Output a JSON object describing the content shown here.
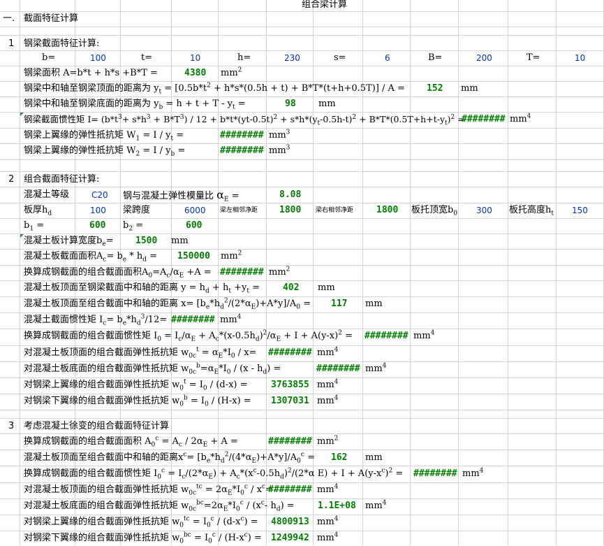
{
  "title": "组合梁计算",
  "s1": {
    "header_num": "一.",
    "header": "截面特征计算",
    "num": "1",
    "label": "钢梁截面特征计算:",
    "params": [
      {
        "k": "b=",
        "v": "100"
      },
      {
        "k": "t=",
        "v": "10"
      },
      {
        "k": "h=",
        "v": "230"
      },
      {
        "k": "s=",
        "v": "6"
      },
      {
        "k": "B=",
        "v": "200"
      },
      {
        "k": "T=",
        "v": "10"
      }
    ],
    "area_label": "钢梁面积  A=b*t + h*s +B*T =",
    "area_val": "4380",
    "area_unit": "mm",
    "yt_label": "钢梁中和轴至钢梁顶面的距离为 y",
    "yt_expr": " = [0.5b*t",
    "yt_expr2": " + h*s*(0.5h + t) + B*T*(t+h+0.5T)] / A =",
    "yt_val": "152",
    "yt_unit": "mm",
    "yb_label": "钢梁中和轴至钢梁底面的距离为 y",
    "yb_expr": " = h + t + T - y",
    "yb_eq": " =",
    "yb_val": "98",
    "yb_unit": "mm",
    "I_label": "钢梁截面惯性矩 I= (b*t",
    "I_expr": "+ s*h",
    "I_expr2": " + B*T",
    "I_expr3": ") / 12 + b*t*(yt-0.5t)",
    "I_expr4": " + s*h*(y",
    "I_expr5": "-0.5h-t)",
    "I_expr6": " + B*T*(0.5T+h+t-y",
    "I_expr7": ")",
    "I_eq": " =",
    "I_val": "########",
    "I_unit": "mm",
    "W1_label": "钢梁上翼缘的弹性抵抗矩 W",
    "W1_expr": " = I / y",
    "W1_eq": " =",
    "W1_val": "########",
    "W1_unit": "mm",
    "W2_label": "钢梁上翼缘的弹性抵抗矩 W",
    "W2_expr": " = I / y",
    "W2_eq": " =",
    "W2_val": "########",
    "W2_unit": "mm"
  },
  "s2": {
    "num": "2",
    "label": "组合截面特征计算:",
    "conc_grade_label": "混凝土等级",
    "conc_grade": "C20",
    "ratio_label": "钢与混凝土弹性模量比",
    "ratio_sym": "α",
    "ratio_sub": "E",
    "ratio_eq": " =",
    "ratio_val": "8.08",
    "hd_label": "板厚h",
    "hd_sub": "d",
    "hd_val": "100",
    "span_label": "梁跨度",
    "span_val": "6000",
    "left_clear_label": "梁左相邻净距",
    "left_clear_val": "1800",
    "right_clear_label": "梁右相邻净距",
    "right_clear_val": "1800",
    "b0_label": "板托顶宽b",
    "b0_sub": "0",
    "b0_val": "300",
    "ht_label": "板托高度h",
    "ht_sub": "t",
    "ht_val": "150",
    "b1_label": "b",
    "b1_sub": "1",
    "b1_eq": " =",
    "b1_val": "600",
    "b2_label": "b",
    "b2_sub": "2",
    "b2_eq": " =",
    "b2_val": "600",
    "be_label": "混凝土板计算宽度b",
    "be_sub": "e",
    "be_eq": "=",
    "be_val": "1500",
    "be_unit": "mm",
    "Ac_label": "混凝土板截面面积A",
    "Ac_expr": "= b",
    "Ac_expr2": " * h",
    "Ac_eq": " =",
    "Ac_val": "150000",
    "Ac_unit": "mm",
    "A0_label": "换算成钢截面的组合截面面积A",
    "A0_expr": "=A",
    "A0_expr2": "/α",
    "A0_expr3": " +A =",
    "A0_val": "########",
    "A0_unit": "mm",
    "y_label": "混凝土板顶面至钢梁截面中和轴的距离 y = h",
    "y_expr": " + h",
    "y_expr2": " +y",
    "y_eq": " =",
    "y_val": "402",
    "y_unit": "mm",
    "x_label": "混凝土板顶面至组合截面中和轴的距离 x= [b",
    "x_expr": "*h",
    "x_expr2": "/(2*α",
    "x_expr3": ")+A*y]/A",
    "x_eq": " =",
    "x_val": "117",
    "x_unit": "mm",
    "Ic_label": "混凝土截面惯性矩 I",
    "Ic_expr": "= b",
    "Ic_expr2": "*h",
    "Ic_expr3": "/12=",
    "Ic_val": "########",
    "Ic_unit": "mm",
    "I0_label": "换算成钢截面的组合截面惯性矩 I",
    "I0_expr": " = I",
    "I0_expr2": "/α",
    "I0_expr3": " + A",
    "I0_expr4": "*(x-0.5h",
    "I0_expr5": ")",
    "I0_expr6": "/α",
    "I0_expr7": " + I + A(y-x)",
    "I0_eq": " =",
    "I0_val": "########",
    "I0_unit": "mm",
    "w0ct_label": "对混凝土板顶面的组合截面弹性抵抗矩 w",
    "w0ct_expr": " = α",
    "w0ct_expr2": "*I",
    "w0ct_expr3": " / x=",
    "w0ct_val": "########",
    "w0ct_unit": "mm",
    "w0cb_label": "对混凝土板底面的组合截面弹性抵抗矩 w",
    "w0cb_expr": "=α",
    "w0cb_expr2": "*I",
    "w0cb_expr3": " / (x - h",
    "w0cb_expr4": ") =",
    "w0cb_val": "########",
    "w0cb_unit": "mm",
    "w0t_label": "对钢梁上翼缘的组合截面弹性抵抗矩 w",
    "w0t_expr": " = I",
    "w0t_expr2": " / (d-x) =",
    "w0t_val": "3763855",
    "w0t_unit": "mm",
    "w0b_label": "对钢梁下翼缘的组合截面弹性抵抗矩 w",
    "w0b_expr": " = I",
    "w0b_expr2": " / (H-x) =",
    "w0b_val": "1307031",
    "w0b_unit": "mm"
  },
  "s3": {
    "num": "3",
    "label": "考虑混凝土徐变的组合截面特征计算",
    "A0c_label": "换算成钢截面的组合截面面积 A",
    "A0c_expr": " = A",
    "A0c_expr2": " / 2α",
    "A0c_expr3": " + A =",
    "A0c_val": "########",
    "A0c_unit": "mm",
    "xc_label": "混凝土板顶面至组合截面中和轴的距离x",
    "xc_expr": "= [b",
    "xc_expr2": "*h",
    "xc_expr3": "/(4*α",
    "xc_expr4": ")+A*y]/A",
    "xc_eq": " =",
    "xc_val": "162",
    "xc_unit": "mm",
    "I0c_label": "换算成钢截面的组合截面惯性矩 I",
    "I0c_expr": " = I",
    "I0c_expr2": "/(2*α",
    "I0c_expr3": ") + A",
    "I0c_expr4": "*(x",
    "I0c_expr5": "-0.5h",
    "I0c_expr6": ")",
    "I0c_expr7": "/(2*α E) + I + A(y-x",
    "I0c_expr8": ")",
    "I0c_eq": " =",
    "I0c_val": "########",
    "I0c_unit": "mm",
    "w0ctc_label": "对混凝土板顶面的组合截面弹性抵抗矩 w",
    "w0ctc_expr": " = 2α",
    "w0ctc_expr2": "*I",
    "w0ctc_expr3": " / x",
    "w0ctc_eq": "=",
    "w0ctc_val": "########",
    "w0ctc_unit": "mm",
    "w0cbc_label": "对混凝土板底面的组合截面弹性抵抗矩 w",
    "w0cbc_expr": "=2α",
    "w0cbc_expr2": "*I",
    "w0cbc_expr3": " / (x",
    "w0cbc_expr4": "- h",
    "w0cbc_expr5": ") =",
    "w0cbc_val": "1.1E+08",
    "w0cbc_unit": "mm",
    "w0tc_label": "对钢梁上翼缘的组合截面弹性抵抗矩 w",
    "w0tc_expr": " = I",
    "w0tc_expr2": " / (d-x",
    "w0tc_expr3": ") =",
    "w0tc_val": "4800913",
    "w0tc_unit": "mm",
    "w0bc_label": "对钢梁下翼缘的组合截面弹性抵抗矩 w",
    "w0bc_expr": " = I",
    "w0bc_expr2": " / (H-x",
    "w0bc_expr3": ") =",
    "w0bc_val": "1249942",
    "w0bc_unit": "mm"
  },
  "supers": {
    "two": "2",
    "three": "3",
    "four": "4",
    "t": "t",
    "b": "b",
    "c": "c",
    "tc": "tc",
    "bc": "bc"
  },
  "subs": {
    "t": "t",
    "b": "b",
    "one": "1",
    "two": "2",
    "zero": "0",
    "c": "c",
    "e": "e",
    "d": "d",
    "E": "E",
    "zeroc": "0c"
  },
  "colors": {
    "grid": "#d4d4d4",
    "value_green": "#008000",
    "input_blue": "#0033cc"
  }
}
